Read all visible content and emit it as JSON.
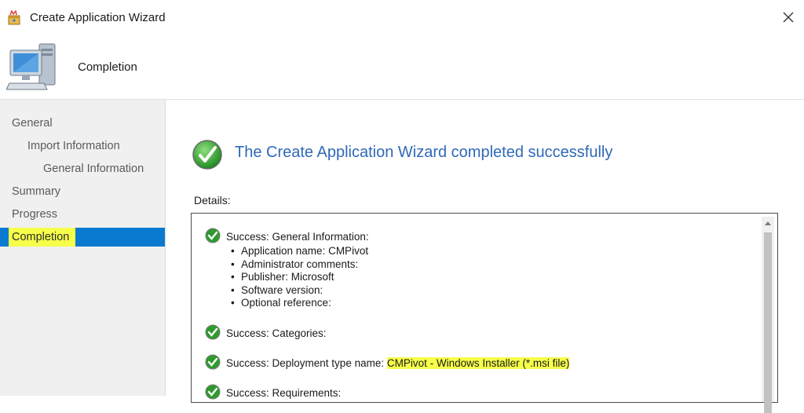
{
  "window": {
    "title": "Create Application Wizard",
    "title_icon": "wizard-icon",
    "close_icon": "close-icon"
  },
  "header": {
    "title": "Completion",
    "icon": "computer-icon"
  },
  "nav": {
    "items": [
      {
        "label": "General",
        "level": 0
      },
      {
        "label": "Import Information",
        "level": 1
      },
      {
        "label": "General Information",
        "level": 2
      },
      {
        "label": "Summary",
        "level": 0
      },
      {
        "label": "Progress",
        "level": 0
      },
      {
        "label": "Completion",
        "level": 0,
        "active": true
      }
    ]
  },
  "main": {
    "status_icon": "green-check-icon",
    "status_text": "The Create Application Wizard completed successfully",
    "details_label": "Details:",
    "entries": [
      {
        "heading": "Success: General Information:",
        "bullets": [
          "Application name: CMPivot",
          "Administrator comments:",
          "Publisher: Microsoft",
          "Software version:",
          "Optional reference:"
        ]
      },
      {
        "heading": "Success: Categories:",
        "bullets": []
      },
      {
        "heading": "Success: Deployment type name:",
        "heading_highlight": "CMPivot - Windows Installer (*.msi file)",
        "bullets": []
      },
      {
        "heading": "Success: Requirements:",
        "bullets": []
      }
    ]
  },
  "colors": {
    "accent_blue": "#2f68b8",
    "selection": "#0a7ad1",
    "highlight": "#f6ff4a",
    "nav_bg": "#f0f0f0",
    "success_green": "#2e9a2e"
  }
}
